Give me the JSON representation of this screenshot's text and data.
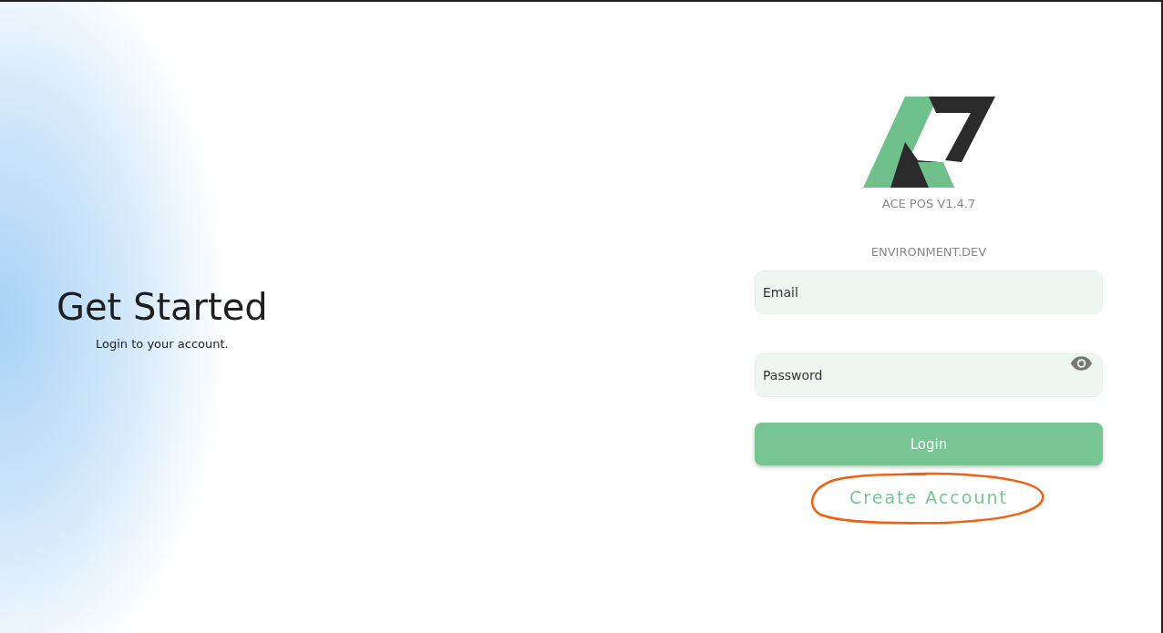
{
  "intro": {
    "title": "Get Started",
    "subtitle": "Login to your account."
  },
  "brand": {
    "version": "ACE POS V1.4.7",
    "environment": "ENVIRONMENT.DEV"
  },
  "form": {
    "email": {
      "placeholder": "Email"
    },
    "password": {
      "placeholder": "Password"
    },
    "submit": "Login",
    "create_account": "Create Account",
    "create_account_circled": true
  }
}
